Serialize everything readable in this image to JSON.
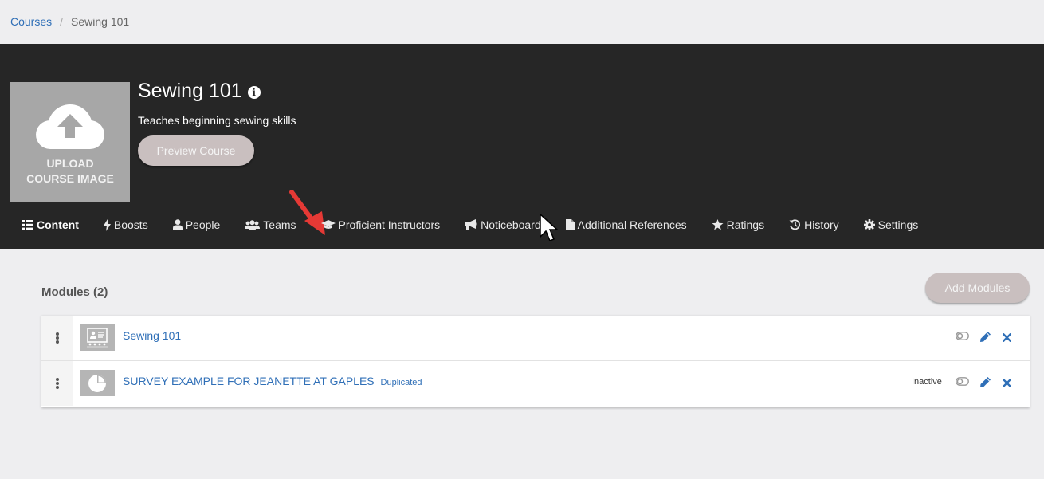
{
  "breadcrumb": {
    "root": "Courses",
    "separator": "/",
    "current": "Sewing 101"
  },
  "course": {
    "title": "Sewing 101",
    "description": "Teaches beginning sewing skills",
    "upload_line1": "UPLOAD",
    "upload_line2": "COURSE IMAGE",
    "preview_label": "Preview Course",
    "info_glyph": "i"
  },
  "tabs": [
    {
      "label": "Content",
      "icon": "list-icon",
      "active": true
    },
    {
      "label": "Boosts",
      "icon": "bolt-icon"
    },
    {
      "label": "People",
      "icon": "user-icon"
    },
    {
      "label": "Teams",
      "icon": "users-icon"
    },
    {
      "label": "Proficient Instructors",
      "icon": "graduation-cap-icon"
    },
    {
      "label": "Noticeboard",
      "icon": "megaphone-icon"
    },
    {
      "label": "Additional References",
      "icon": "file-icon"
    },
    {
      "label": "Ratings",
      "icon": "star-icon"
    },
    {
      "label": "History",
      "icon": "history-icon"
    },
    {
      "label": "Settings",
      "icon": "gear-icon"
    }
  ],
  "modules": {
    "title": "Modules (2)",
    "add_label": "Add Modules",
    "items": [
      {
        "name": "Sewing 101",
        "tag": "",
        "status": "",
        "icon": "presentation-icon"
      },
      {
        "name": "SURVEY EXAMPLE FOR JEANETTE AT GAPLES",
        "tag": "Duplicated",
        "status": "Inactive",
        "icon": "pie-chart-icon"
      }
    ]
  },
  "colors": {
    "header_bg": "#262626",
    "link": "#2f6fb7",
    "button_bg": "#c9bfbf",
    "page_bg": "#eeeef0",
    "annotation_arrow": "#e53935"
  }
}
